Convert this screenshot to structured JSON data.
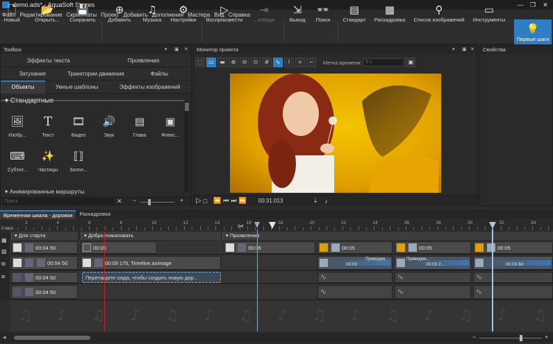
{
  "window": {
    "title": "demo.ads* - AquaSoft Stages",
    "minimize": "—",
    "maximize": "❐",
    "close": "✕"
  },
  "menu": [
    "Файл",
    "Редактирование",
    "Скрипттаты",
    "Проект",
    "Добавить",
    "Дополнения",
    "Мастера",
    "Вид",
    "Справка"
  ],
  "toolbar": [
    {
      "label": "Новый",
      "icon": "🗋"
    },
    {
      "label": "Открыть...",
      "icon": "📂"
    },
    {
      "label": "Сохранить",
      "icon": "💾"
    },
    {
      "label": "Добавить",
      "icon": "⊕"
    },
    {
      "label": "Музыка",
      "icon": "♫"
    },
    {
      "label": "Настройки",
      "icon": "⚙"
    },
    {
      "label": "Воспроизвести",
      "icon": "▷"
    },
    {
      "label": "...отвода",
      "icon": "⇥"
    },
    {
      "label": "Вывод",
      "icon": "⇲"
    },
    {
      "label": "Поиск",
      "icon": "👓"
    },
    {
      "label": "Стандарт",
      "icon": "▤"
    },
    {
      "label": "Раскадровка",
      "icon": "▦"
    },
    {
      "label": "Список изображений",
      "icon": "⚲"
    },
    {
      "label": "Инструменты",
      "icon": "▭"
    },
    {
      "label": "Первые шаги",
      "icon": "💡"
    }
  ],
  "toolbox": {
    "title": "Toolbox",
    "tabs_row1": [
      "Эффекты текста",
      "Проявления"
    ],
    "tabs_row2": [
      "Затухания",
      "Траектории движения",
      "Файлы"
    ],
    "tabs_row3": [
      "Объекты",
      "Умные шаблоны",
      "Эффекты изображений"
    ],
    "section1": "Стандартные",
    "section2": "Анимированные маршруты",
    "items": [
      {
        "label": "Изобр...",
        "icon": "🖼"
      },
      {
        "label": "Текст",
        "icon": "T"
      },
      {
        "label": "Видео",
        "icon": "🎞"
      },
      {
        "label": "Звук",
        "icon": "🔊"
      },
      {
        "label": "Глава",
        "icon": "▤"
      },
      {
        "label": "Флекс...",
        "icon": "▣"
      },
      {
        "label": "Субтит...",
        "icon": "⌨"
      },
      {
        "label": "Частицы",
        "icon": "✨"
      },
      {
        "label": "Запол...",
        "icon": "⟦⟧"
      }
    ],
    "search_placeholder": "Поиск"
  },
  "monitor": {
    "title": "Монитор проекта",
    "timecode_label": "Метка времени:",
    "timecode_value": "0 с",
    "time": "00:31.013"
  },
  "properties": {
    "title": "Свойства"
  },
  "timeline": {
    "tabs": [
      "Временная шкала - дорожки",
      "Раскадровка"
    ],
    "ruler_start": "0 мин",
    "ruler_numbers": [
      "2",
      "4",
      "6",
      "8",
      "10",
      "12",
      "14",
      "16",
      "18",
      "20",
      "22",
      "24",
      "26",
      "28",
      "30",
      "32",
      "34"
    ],
    "chapters": [
      "Для старта",
      "Добро пожаловать",
      "Проявления"
    ],
    "clips": {
      "a1": "00:04 50",
      "a2": "00:05",
      "a3": "00:06",
      "a4": "00:05",
      "a5": "00:05",
      "a6": "00:05",
      "b1": "00:04 50",
      "b2": "00:09 175, Timeline.asimage",
      "c1": "00:04 50",
      "c2": "Перетащите сюда, чтобы создать новую дор...",
      "d1": "00:04 50",
      "f1": "00:03",
      "f1b": "Приведем...",
      "f2": "Приведем...",
      "f2b": "00:03 2...",
      "f3": "00:03 60"
    }
  },
  "colors": {
    "accent": "#2f7ec4",
    "playhead": "#d02020"
  }
}
